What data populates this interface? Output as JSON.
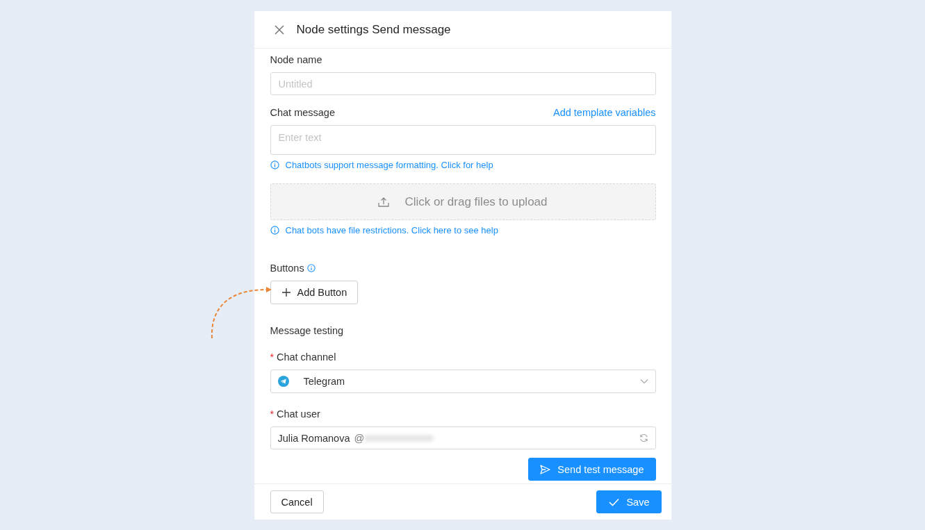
{
  "dialog": {
    "title": "Node settings Send message"
  },
  "node_name": {
    "label": "Node name",
    "placeholder": "Untitled"
  },
  "chat_message": {
    "label": "Chat message",
    "link": "Add template variables",
    "placeholder": "Enter text",
    "help": "Chatbots support message formatting. Click for help"
  },
  "upload": {
    "text": "Click or drag files to upload",
    "help": "Chat bots have file restrictions. Click here to see help"
  },
  "buttons_section": {
    "label": "Buttons",
    "add_button": "Add Button"
  },
  "message_testing": {
    "title": "Message testing",
    "chat_channel": {
      "marker": "*",
      "label": "Chat channel",
      "value": "Telegram"
    },
    "chat_user": {
      "marker": "*",
      "label": "Chat user",
      "value": "Julia Romanova",
      "handle_prefix": "@"
    },
    "send_button": "Send test message"
  },
  "footer": {
    "cancel": "Cancel",
    "save": "Save"
  }
}
